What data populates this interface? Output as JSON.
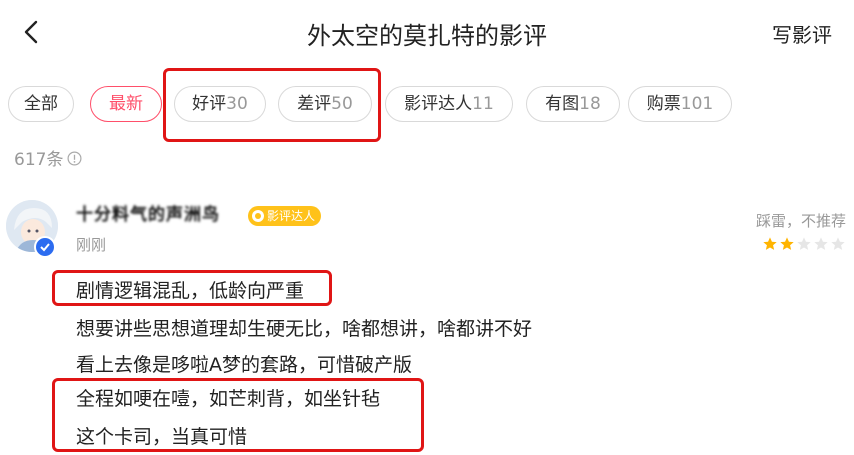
{
  "header": {
    "title": "外太空的莫扎特的影评",
    "write_label": "写影评"
  },
  "filters": [
    {
      "label": "全部",
      "count": ""
    },
    {
      "label": "最新",
      "count": ""
    },
    {
      "label": "好评",
      "count": "30"
    },
    {
      "label": "差评",
      "count": "50"
    },
    {
      "label": "影评达人",
      "count": "11"
    },
    {
      "label": "有图",
      "count": "18"
    },
    {
      "label": "购票",
      "count": "101"
    }
  ],
  "active_filter": "最新",
  "summary": {
    "total": "617条"
  },
  "review": {
    "username": "十分料气的声洲鸟",
    "badge": "影评达人",
    "time": "刚刚",
    "rating_text": "踩雷，不推荐",
    "rating": 2,
    "max_rating": 5,
    "lines": [
      "剧情逻辑混乱，低龄向严重",
      "想要讲些思想道理却生硬无比，啥都想讲，啥都讲不好",
      "看上去像是哆啦A梦的套路，可惜破产版",
      "全程如哽在噎，如芒刺背，如坐针毡",
      "这个卡司，当真可惜"
    ]
  },
  "colors": {
    "accent": "#ff4f6a",
    "highlight": "#e01515",
    "star": "#ffb400",
    "star_empty": "#e6e6e6",
    "badge": "#ffc21a"
  }
}
